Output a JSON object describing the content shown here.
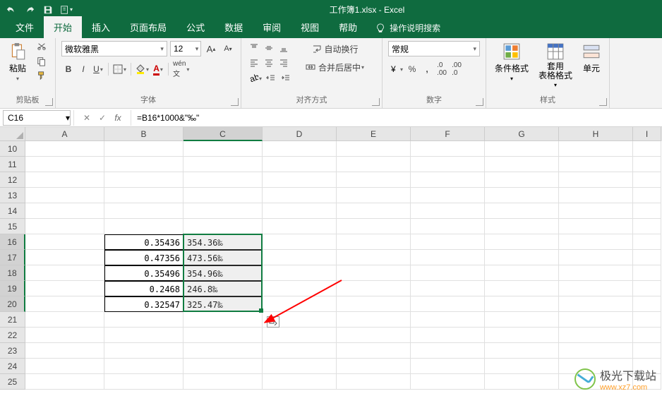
{
  "app": {
    "title": "工作簿1.xlsx - Excel"
  },
  "tabs": {
    "file": "文件",
    "home": "开始",
    "insert": "插入",
    "layout": "页面布局",
    "formulas": "公式",
    "data": "数据",
    "review": "审阅",
    "view": "视图",
    "help": "帮助",
    "tellme": "操作说明搜索"
  },
  "ribbon": {
    "clipboard": {
      "label": "剪贴板",
      "paste": "粘贴"
    },
    "font": {
      "label": "字体",
      "name": "微软雅黑",
      "size": "12"
    },
    "align": {
      "label": "对齐方式",
      "wrap": "自动换行",
      "merge": "合并后居中"
    },
    "number": {
      "label": "数字",
      "format": "常规"
    },
    "styles": {
      "label": "样式",
      "cond": "条件格式",
      "table": "套用\n表格格式",
      "cell": "单元"
    }
  },
  "formulaBar": {
    "ref": "C16",
    "formula": "=B16*1000&\"‰\""
  },
  "columns": [
    "A",
    "B",
    "C",
    "D",
    "E",
    "F",
    "G",
    "H",
    "I"
  ],
  "colWidths": [
    "colA",
    "colB",
    "colC",
    "colD",
    "colE",
    "colF",
    "colG",
    "colH",
    "colI"
  ],
  "rowStart": 10,
  "rowEnd": 25,
  "cells": {
    "B16": "0.35436",
    "B17": "0.47356",
    "B18": "0.35496",
    "B19": "0.2468",
    "B20": "0.32547",
    "C16": "354.36‰",
    "C17": "473.56‰",
    "C18": "354.96‰",
    "C19": "246.8‰",
    "C20": "325.47‰"
  },
  "selection": {
    "col": "C",
    "startRow": 16,
    "endRow": 20
  },
  "watermark": {
    "name": "极光下载站",
    "url": "www.xz7.com"
  },
  "chart_data": {
    "type": "table",
    "columns": [
      "B (decimal)",
      "C (per-mille)"
    ],
    "rows": [
      [
        0.35436,
        "354.36‰"
      ],
      [
        0.47356,
        "473.56‰"
      ],
      [
        0.35496,
        "354.96‰"
      ],
      [
        0.2468,
        "246.8‰"
      ],
      [
        0.32547,
        "325.47‰"
      ]
    ],
    "formula": "=B*1000&\"‰\""
  }
}
